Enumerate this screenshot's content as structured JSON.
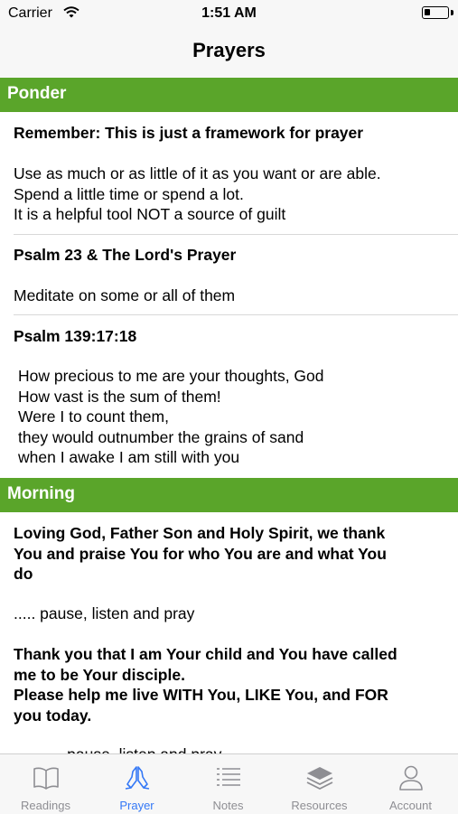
{
  "status_bar": {
    "carrier": "Carrier",
    "time": "1:51 AM"
  },
  "nav": {
    "title": "Prayers"
  },
  "sections": {
    "ponder": {
      "header": "Ponder",
      "remember": {
        "title": "Remember:  This is just a framework for prayer",
        "lines": [
          "Use as much or as little of it as you want or are able.",
          "Spend a little time or spend a lot.",
          "It is a helpful tool NOT a source of guilt"
        ]
      },
      "psalm23": {
        "title": "Psalm 23 & The Lord's Prayer",
        "text": "Meditate on some or all of them"
      },
      "psalm139": {
        "title": "Psalm 139:17:18",
        "lines": [
          "How precious to me are your thoughts, God",
          "How vast is the sum of them!",
          "Were I to count them,",
          "they would outnumber the grains of sand",
          "when I awake I am still with you"
        ]
      }
    },
    "morning": {
      "header": "Morning",
      "prayer1_lines": [
        "Loving God, Father Son and Holy Spirit, we thank",
        "You and praise You for who You are and what You",
        "do"
      ],
      "pause": "..... pause, listen and pray",
      "prayer2_lines": [
        "Thank you that I am Your child and You have called",
        "me to be Your disciple.",
        "Please help me live WITH You, LIKE You, and FOR",
        "you today."
      ],
      "pause2": "..... pause, listen and pray"
    }
  },
  "tabs": [
    {
      "label": "Readings",
      "icon": "book-icon",
      "active": false
    },
    {
      "label": "Prayer",
      "icon": "praying-hands-icon",
      "active": true
    },
    {
      "label": "Notes",
      "icon": "list-icon",
      "active": false
    },
    {
      "label": "Resources",
      "icon": "layers-icon",
      "active": false
    },
    {
      "label": "Account",
      "icon": "person-icon",
      "active": false
    }
  ],
  "colors": {
    "section_header": "#5aa52a",
    "tab_active": "#3478f6",
    "tab_inactive": "#8e8e93"
  }
}
